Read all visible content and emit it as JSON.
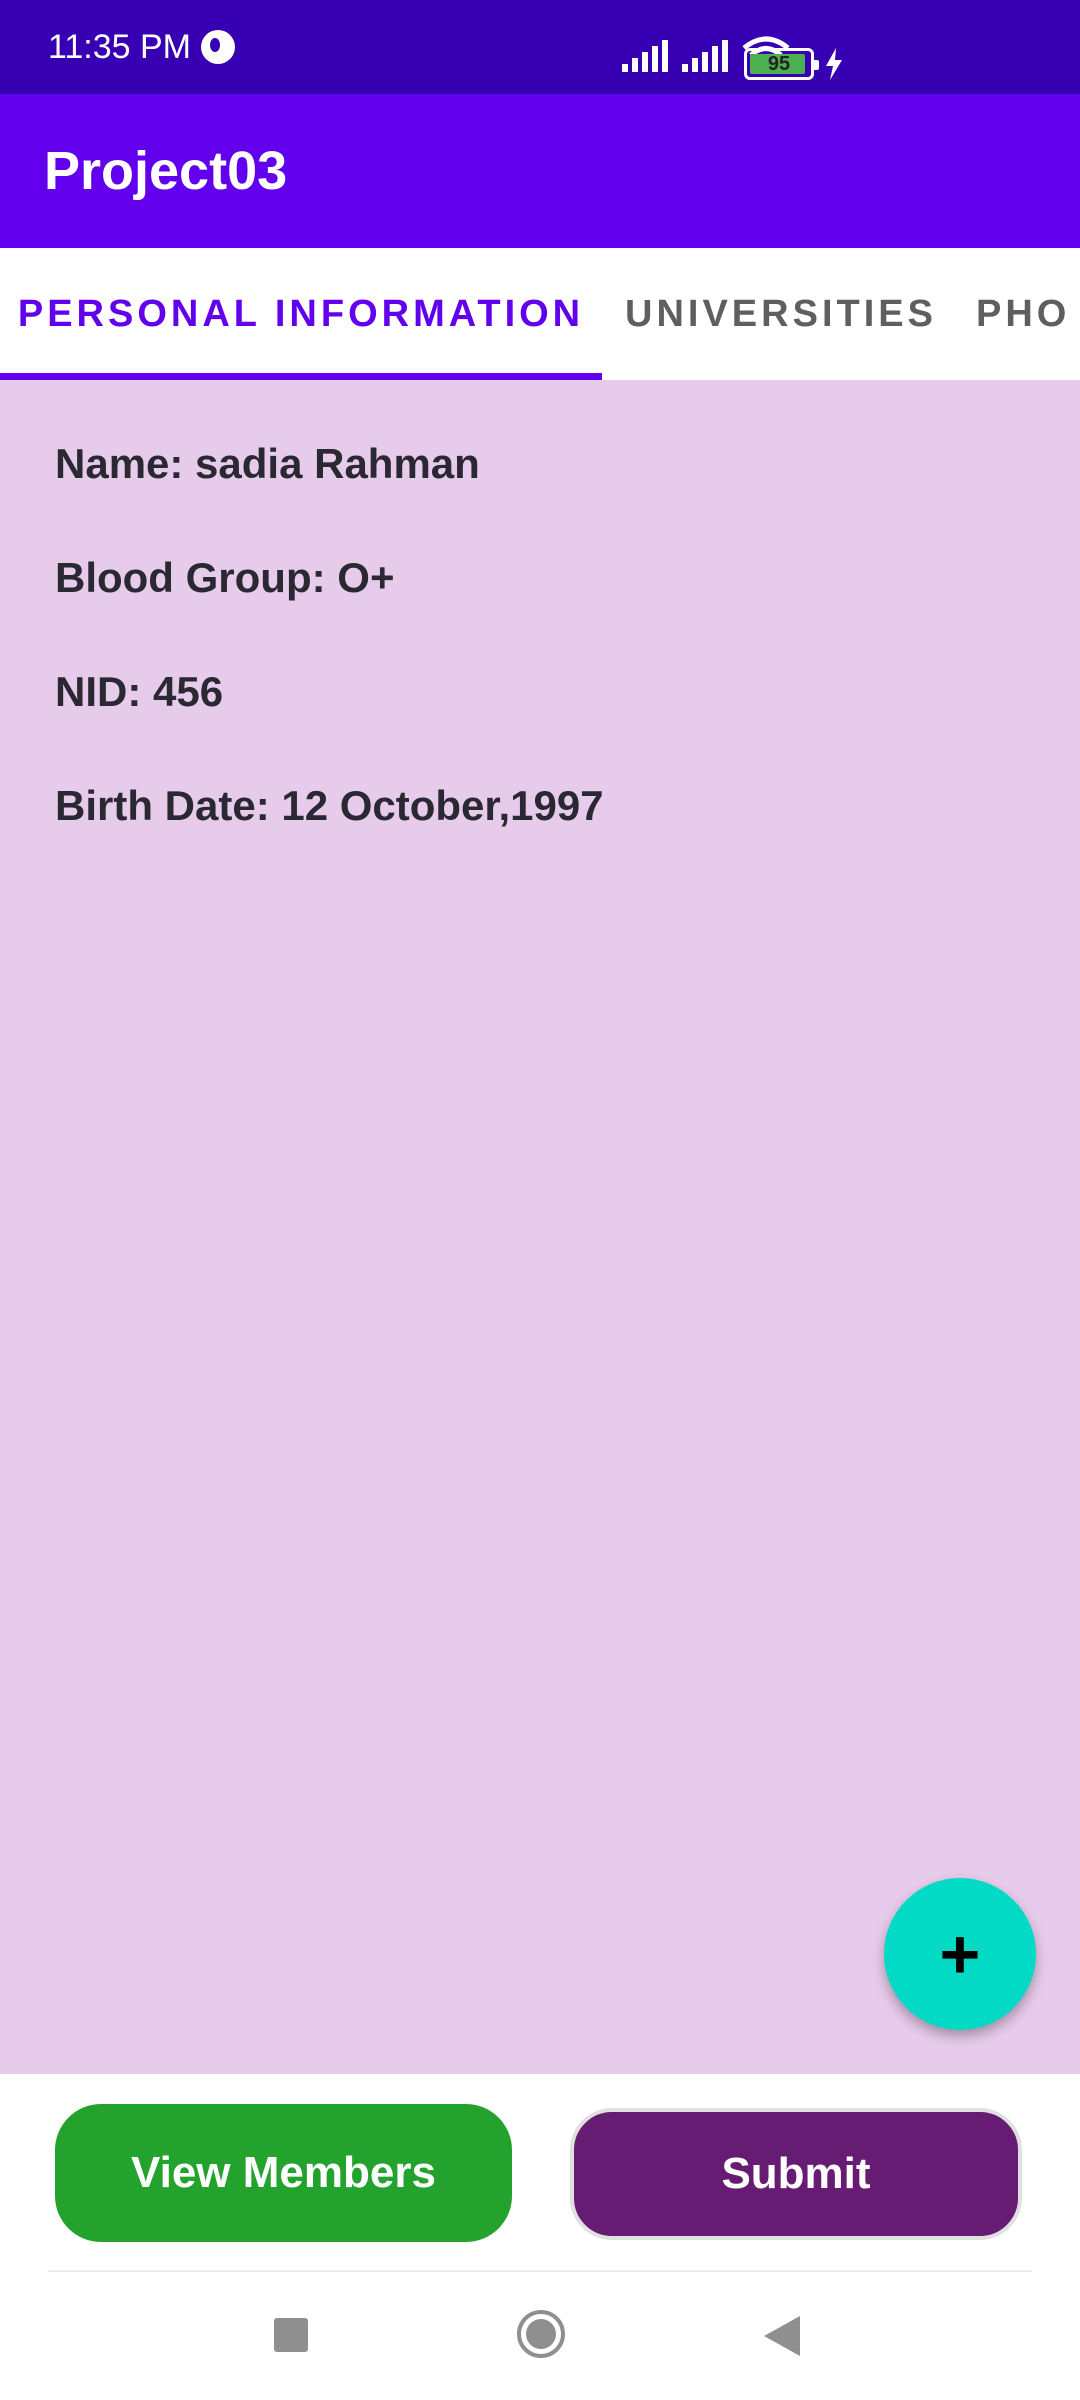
{
  "status_bar": {
    "time": "11:35 PM",
    "battery_level": "95",
    "icons": [
      "clock-icon",
      "signal-icon",
      "signal-icon",
      "wifi-icon",
      "battery-icon",
      "charging-bolt-icon"
    ]
  },
  "app_bar": {
    "title": "Project03"
  },
  "tabs": [
    {
      "label": "PERSONAL INFORMATION",
      "selected": true
    },
    {
      "label": "UNIVERSITIES",
      "selected": false
    },
    {
      "label": "PHO",
      "selected": false
    }
  ],
  "personal_info": {
    "name": "Name: sadia Rahman",
    "blood_group": "Blood Group: O+",
    "nid": "NID: 456",
    "birth_date": "Birth Date: 12 October,1997"
  },
  "fab": {
    "icon": "plus-icon",
    "symbol": "+"
  },
  "buttons": {
    "view_members": "View Members",
    "submit": "Submit"
  },
  "nav_bar": {
    "icons": [
      "recents-square-icon",
      "home-circle-icon",
      "back-triangle-icon"
    ]
  },
  "colors": {
    "status_bar": "#3700b3",
    "app_bar": "#6200ee",
    "content_bg": "#e6cbea",
    "fab": "#03dac5",
    "view_members": "#23a32e",
    "submit": "#651c72"
  }
}
